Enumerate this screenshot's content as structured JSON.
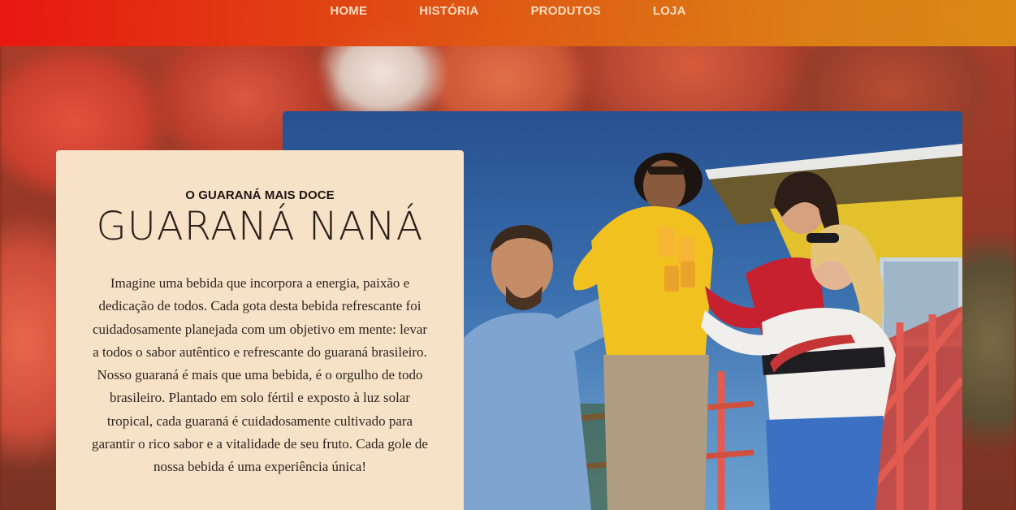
{
  "nav": {
    "items": [
      {
        "label": "HOME"
      },
      {
        "label": "HISTÓRIA"
      },
      {
        "label": "PRODUTOS"
      },
      {
        "label": "LOJA"
      }
    ]
  },
  "hero": {
    "subtitle": "O GUARANÁ MAIS DOCE",
    "title": "GUARANÁ NANÁ",
    "description": "Imagine uma bebida que incorpora a energia, paixão e dedicação de todos. Cada gota desta bebida refrescante foi cuidadosamente planejada com um objetivo em mente: levar a todos o sabor autêntico e refrescante do guaraná brasileiro. Nosso guaraná é mais que uma bebida, é o orgulho de todo brasileiro. Plantado em solo fértil e exposto à luz solar tropical, cada guaraná é cuidadosamente cultivado para garantir o rico sabor e a vitalidade de seu fruto. Cada gole de nossa bebida é uma experiência única!"
  },
  "colors": {
    "navbar_start": "#ea1610",
    "navbar_end": "#dc8c16",
    "nav_text": "#f6e3c8",
    "card_bg": "#f7e2c7",
    "title_text": "#2a1f19"
  },
  "images": {
    "background": "blurred guarana fruit",
    "photo": "friends toasting with guarana drinks by a lifeguard tower"
  }
}
